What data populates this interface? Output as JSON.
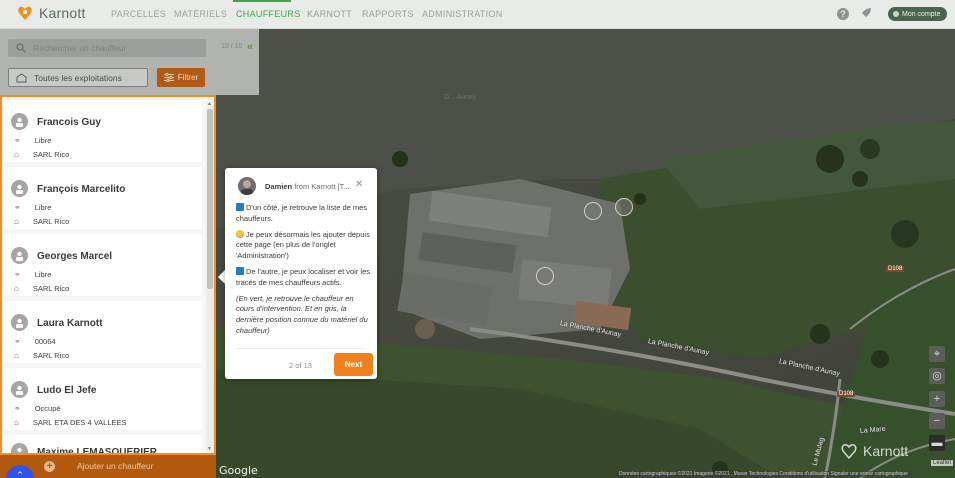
{
  "app": {
    "brand": "Karnott"
  },
  "nav": {
    "items": [
      {
        "label": "PARCELLES",
        "active": false
      },
      {
        "label": "MATÉRIELS",
        "active": false
      },
      {
        "label": "CHAUFFEURS",
        "active": true
      },
      {
        "label": "KARNOTT",
        "active": false
      },
      {
        "label": "RAPPORTS",
        "active": false
      },
      {
        "label": "ADMINISTRATION",
        "active": false
      }
    ],
    "account_label": "Mon compte",
    "help_glyph": "?"
  },
  "sidebar": {
    "search_placeholder": "Rechercher un chauffeur",
    "count": "10 / 10",
    "exploitation_select": "Toutes les exploitations",
    "filter_label": "Filtrer",
    "add_label": "Ajouter un chauffeur",
    "drivers": [
      {
        "name": "Francois Guy",
        "status": "Libre",
        "company": "SARL Rico"
      },
      {
        "name": "François Marcelito",
        "status": "Libre",
        "company": "SARL Rico"
      },
      {
        "name": "Georges Marcel",
        "status": "Libre",
        "company": "SARL Rico"
      },
      {
        "name": "Laura Karnott",
        "status": "00064",
        "company": "SARL Rico"
      },
      {
        "name": "Ludo El Jefe",
        "status": "Occupé",
        "company": "SARL ETA DES 4 VALLEES"
      },
      {
        "name": "Maxime LEMASQUERIER",
        "status": "",
        "company": ""
      }
    ]
  },
  "popover": {
    "sender": "Damien",
    "from_text": "from Karnott [T...",
    "paragraphs": [
      "D'un côté, je retrouve la liste de mes chauffeurs.",
      "Je peux désormais les ajouter depuis cette page (en plus de l'onglet 'Administration')",
      "De l'autre, je peux localiser et voir les tracés de mes chauffeurs actifs."
    ],
    "note": "(En vert, je retrouve le chauffeur en cours d'intervention. Et en gris, la dernière position connue du matériel du chauffeur)",
    "step": "2 of 13",
    "next_label": "Next",
    "close_glyph": "✕"
  },
  "map": {
    "roads": [
      "La Planche d'Aunay",
      "La Planche d'Aunay",
      "La Planche d'Aunay",
      "La Mare",
      "Le Mulag"
    ],
    "badges": [
      "D108",
      "D108"
    ],
    "watermark": "Karnott",
    "google": "Google",
    "attribution": "Données cartographiques ©2021 Imagerie ©2021 , Maxar Technologies    Conditions d'utilisation    Signaler une erreur cartographique",
    "leaflet": "Leaflet",
    "faint_place": "D... Aunay",
    "controls": [
      "locate-icon",
      "center-icon",
      "zoom-in-icon",
      "zoom-out-icon",
      "layers-icon"
    ]
  }
}
